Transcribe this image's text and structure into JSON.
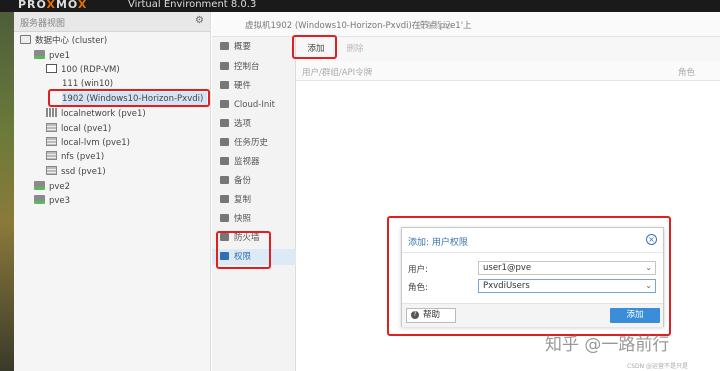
{
  "header": {
    "logo_prefix": "PRO",
    "logo_x": "X",
    "logo_mid": "MO",
    "logo_x2": "X",
    "subtitle": "Virtual Environment 8.0.3"
  },
  "sidebar": {
    "header_label": "服务器视图",
    "tree": [
      {
        "label": "数据中心 (cluster)",
        "icon": "datacenter-icon"
      },
      {
        "label": "pve1",
        "icon": "node-icon"
      },
      {
        "label": "100 (RDP-VM)",
        "icon": "vm-icon"
      },
      {
        "label": "111 (win10)",
        "icon": "vm-icon"
      },
      {
        "label": "1902 (Windows10-Horizon-Pxvdi)",
        "icon": "vm-icon"
      },
      {
        "label": "localnetwork (pve1)",
        "icon": "network-icon"
      },
      {
        "label": "local (pve1)",
        "icon": "storage-icon"
      },
      {
        "label": "local-lvm (pve1)",
        "icon": "storage-icon"
      },
      {
        "label": "nfs (pve1)",
        "icon": "storage-icon"
      },
      {
        "label": "ssd (pve1)",
        "icon": "storage-icon"
      },
      {
        "label": "pve2",
        "icon": "node-icon"
      },
      {
        "label": "pve3",
        "icon": "node-icon"
      }
    ]
  },
  "titlebar": {
    "title": "虚拟机1902 (Windows10-Horizon-Pxvdi)在节点'pve1'上",
    "notes": "没有标记"
  },
  "tabs": [
    {
      "label": "概要"
    },
    {
      "label": "控制台"
    },
    {
      "label": "硬件"
    },
    {
      "label": "Cloud-Init"
    },
    {
      "label": "选项"
    },
    {
      "label": "任务历史"
    },
    {
      "label": "监视器"
    },
    {
      "label": "备份"
    },
    {
      "label": "复制"
    },
    {
      "label": "快照"
    },
    {
      "label": "防火墙"
    },
    {
      "label": "权限"
    }
  ],
  "toolbar": {
    "add": "添加",
    "remove": "删除"
  },
  "grid": {
    "col_user": "用户/群组/API令牌",
    "col_role": "角色"
  },
  "dialog": {
    "title": "添加: 用户权限",
    "user_label": "用户:",
    "user_value": "user1@pve",
    "role_label": "角色:",
    "role_value": "PxvdiUsers",
    "help": "帮助",
    "add": "添加"
  },
  "watermark": {
    "text": "知乎 @一路前行",
    "small": "CSDN @运营不是只是"
  }
}
